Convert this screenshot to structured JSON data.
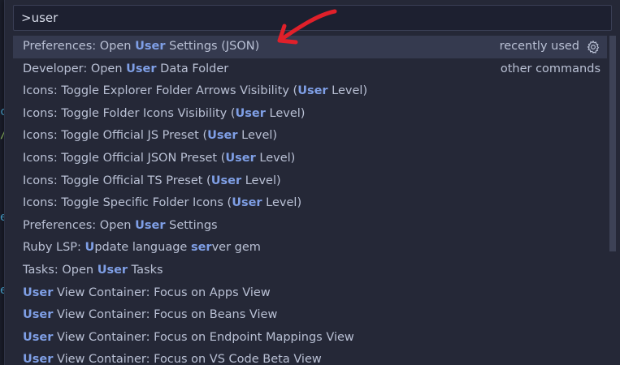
{
  "search": {
    "value": ">user"
  },
  "items": [
    {
      "parts": [
        {
          "t": "Preferences: Open ",
          "h": false
        },
        {
          "t": "User",
          "h": true
        },
        {
          "t": " Settings (JSON)",
          "h": false
        }
      ],
      "right": "recently used",
      "selected": true
    },
    {
      "parts": [
        {
          "t": "Developer: Open ",
          "h": false
        },
        {
          "t": "User",
          "h": true
        },
        {
          "t": " Data Folder",
          "h": false
        }
      ],
      "right": "other commands"
    },
    {
      "parts": [
        {
          "t": "Icons: Toggle Explorer Folder Arrows Visibility (",
          "h": false
        },
        {
          "t": "User",
          "h": true
        },
        {
          "t": " Level)",
          "h": false
        }
      ]
    },
    {
      "parts": [
        {
          "t": "Icons: Toggle Folder Icons Visibility (",
          "h": false
        },
        {
          "t": "User",
          "h": true
        },
        {
          "t": " Level)",
          "h": false
        }
      ]
    },
    {
      "parts": [
        {
          "t": "Icons: Toggle Official JS Preset (",
          "h": false
        },
        {
          "t": "User",
          "h": true
        },
        {
          "t": " Level)",
          "h": false
        }
      ]
    },
    {
      "parts": [
        {
          "t": "Icons: Toggle Official JSON Preset (",
          "h": false
        },
        {
          "t": "User",
          "h": true
        },
        {
          "t": " Level)",
          "h": false
        }
      ]
    },
    {
      "parts": [
        {
          "t": "Icons: Toggle Official TS Preset (",
          "h": false
        },
        {
          "t": "User",
          "h": true
        },
        {
          "t": " Level)",
          "h": false
        }
      ]
    },
    {
      "parts": [
        {
          "t": "Icons: Toggle Specific Folder Icons (",
          "h": false
        },
        {
          "t": "User",
          "h": true
        },
        {
          "t": " Level)",
          "h": false
        }
      ]
    },
    {
      "parts": [
        {
          "t": "Preferences: Open ",
          "h": false
        },
        {
          "t": "User",
          "h": true
        },
        {
          "t": " Settings",
          "h": false
        }
      ]
    },
    {
      "parts": [
        {
          "t": "Ruby LSP: ",
          "h": false
        },
        {
          "t": "U",
          "h": true
        },
        {
          "t": "pdate language ",
          "h": false
        },
        {
          "t": "ser",
          "h": true
        },
        {
          "t": "ver gem",
          "h": false
        }
      ]
    },
    {
      "parts": [
        {
          "t": "Tasks: Open ",
          "h": false
        },
        {
          "t": "User",
          "h": true
        },
        {
          "t": " Tasks",
          "h": false
        }
      ]
    },
    {
      "parts": [
        {
          "t": "User",
          "h": true
        },
        {
          "t": " View Container: Focus on Apps View",
          "h": false
        }
      ]
    },
    {
      "parts": [
        {
          "t": "User",
          "h": true
        },
        {
          "t": " View Container: Focus on Beans View",
          "h": false
        }
      ]
    },
    {
      "parts": [
        {
          "t": "User",
          "h": true
        },
        {
          "t": " View Container: Focus on Endpoint Mappings View",
          "h": false
        }
      ]
    },
    {
      "parts": [
        {
          "t": "User",
          "h": true
        },
        {
          "t": " View Container: Focus on VS Code Beta View",
          "h": false
        }
      ]
    }
  ],
  "colors": {
    "highlight": "#7f9fe6",
    "arrow": "#e0202a"
  },
  "icons": {
    "gear": "gear-icon",
    "annotation": "red-arrow-annotation"
  }
}
